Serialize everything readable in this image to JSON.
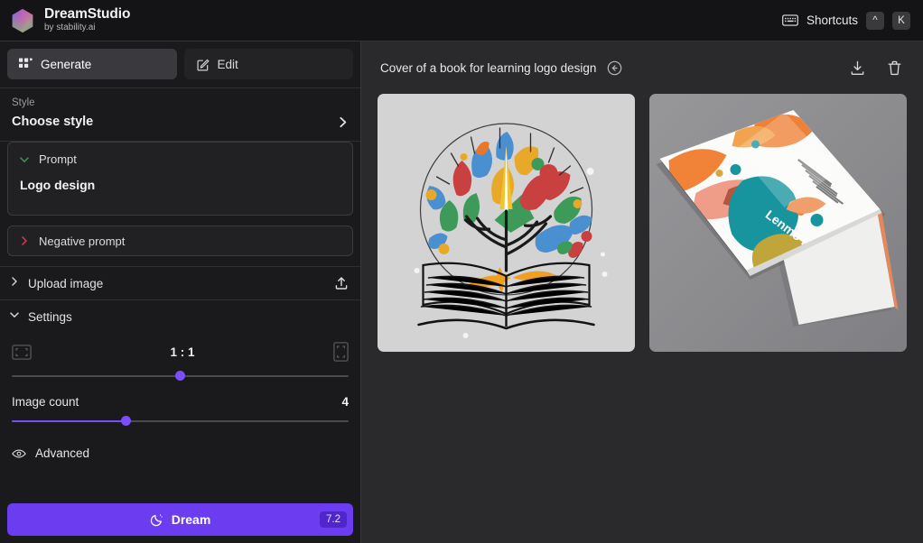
{
  "topbar": {
    "brand_title": "DreamStudio",
    "brand_subtitle": "by stability.ai",
    "logo_icon": "hexagon-gradient-logo",
    "shortcuts_icon": "keyboard-icon",
    "shortcuts_label": "Shortcuts",
    "key_modifier": "^",
    "key_letter": "K"
  },
  "sidebar": {
    "tabs": [
      {
        "label": "Generate",
        "icon": "grid-squares-icon",
        "active": true
      },
      {
        "label": "Edit",
        "icon": "pencil-square-icon",
        "active": false
      }
    ],
    "style": {
      "label": "Style",
      "value": "Choose style",
      "chevron_icon": "chevron-right-icon"
    },
    "prompt": {
      "label": "Prompt",
      "value": "Logo design",
      "caret_icon": "chevron-down-icon",
      "caret_color": "#3c8f5a"
    },
    "negative_prompt": {
      "label": "Negative prompt",
      "caret_icon": "chevron-right-icon",
      "caret_color": "#c33a4a"
    },
    "upload": {
      "label": "Upload image",
      "caret_icon": "chevron-right-icon",
      "action_icon": "upload-icon"
    },
    "settings": {
      "label": "Settings",
      "caret_icon": "chevron-down-icon",
      "aspect_ratio": {
        "value": "1 : 1",
        "left_icon": "landscape-frame-icon",
        "right_icon": "portrait-frame-icon",
        "slider_percent": 50
      },
      "image_count": {
        "label": "Image count",
        "value": "4",
        "slider_percent": 34
      },
      "advanced": {
        "label": "Advanced",
        "icon": "eye-icon"
      }
    },
    "dream_button": {
      "label": "Dream",
      "icon": "moon-icon",
      "badge": "7.2",
      "color": "#6c3cf0"
    }
  },
  "main": {
    "gallery_title": "Cover of a book for learning logo design",
    "back_icon": "arrow-left-circle-icon",
    "download_icon": "download-icon",
    "delete_icon": "trash-icon",
    "images": [
      {
        "alt": "Open book with colorful tree of leaves growing out of pages, flat logo illustration on light gray background",
        "background": "#d3d3d4"
      },
      {
        "alt": "Book cover mockup lying on gray surface with abstract orange, teal and olive shapes",
        "background": "#8e8e90",
        "cover_text": "Lenmo Lcouk"
      }
    ]
  }
}
